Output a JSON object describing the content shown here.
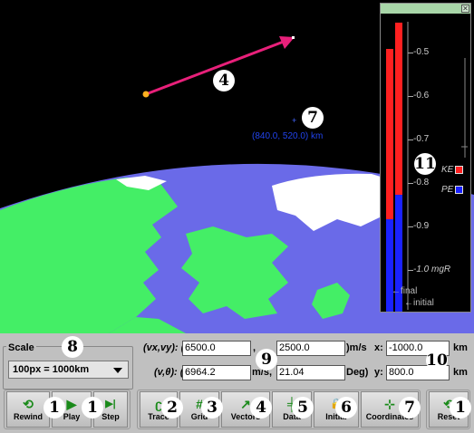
{
  "simulation": {
    "satellite_coordinate": "(840.0, 520.0) km",
    "annotation_numbers": {
      "vector": "4",
      "coordinate": "7",
      "energy": "11"
    }
  },
  "energy_panel": {
    "close_glyph": "✕",
    "ticks": [
      "-0.5",
      "-0.6",
      "-0.7",
      "-0.8",
      "-0.9",
      "-1.0 mgR"
    ],
    "legend": {
      "ke_label": "KE",
      "pe_label": "PE"
    },
    "arrow_labels": {
      "final": "final",
      "initial": "initial"
    },
    "colors": {
      "ke": "#ff2020",
      "pe": "#1a22ff"
    }
  },
  "controls": {
    "scale": {
      "legend": "Scale",
      "value": "100px = 1000km",
      "annotation": "8"
    },
    "velocity_xy": {
      "label": "(vx,vy): (",
      "vx": "6500.0",
      "comma": ",",
      "vy": "2500.0",
      "unit": ")m/s"
    },
    "velocity_polar": {
      "label": "(v,θ): (",
      "v": "6964.2",
      "unit1": "m/s,",
      "theta": "21.04",
      "unit2": "Deg)"
    },
    "position": {
      "x_label": "x:",
      "x": "-1000.0",
      "x_unit": "km",
      "y_label": "y:",
      "y": "800.0",
      "y_unit": "km"
    },
    "annotations": {
      "velocity": "9",
      "position": "10"
    },
    "buttons": {
      "rewind": {
        "label": "Rewind",
        "icon": "⟲"
      },
      "play": {
        "label": "Play",
        "icon": "▶"
      },
      "step": {
        "label": "Step",
        "icon": "▶|"
      },
      "trace": {
        "label": "Trace",
        "icon": "ʗ"
      },
      "grid": {
        "label": "Grid",
        "icon": "#"
      },
      "vectors": {
        "label": "Vectors",
        "icon": "↗"
      },
      "data": {
        "label": "Data",
        "icon": "╪"
      },
      "initial": {
        "label": "Initial",
        "icon": "🔒"
      },
      "coordinates": {
        "label": "Coordinates",
        "icon": "⊹"
      },
      "reset": {
        "label": "Reset",
        "icon": "⟲"
      }
    },
    "button_annotations": {
      "rewind": "1",
      "play": "1",
      "step": "1",
      "trace": "2",
      "grid": "3",
      "vectors": "4",
      "data": "5",
      "initial": "6",
      "coordinates": "7",
      "reset": "1"
    }
  }
}
